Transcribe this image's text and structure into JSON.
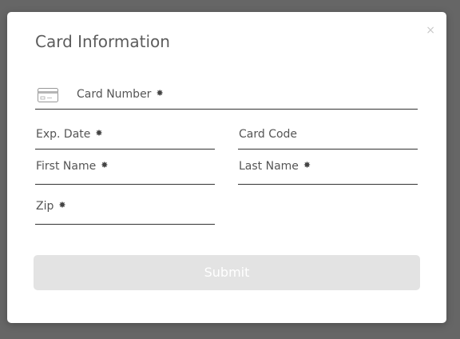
{
  "modal": {
    "title": "Card Information",
    "close_label": "×"
  },
  "form": {
    "card_number": {
      "label": "Card Number",
      "required": true
    },
    "exp_date": {
      "label": "Exp. Date",
      "required": true
    },
    "card_code": {
      "label": "Card Code",
      "required": false
    },
    "first_name": {
      "label": "First Name",
      "required": true
    },
    "last_name": {
      "label": "Last Name",
      "required": true
    },
    "zip": {
      "label": "Zip",
      "required": true
    },
    "required_marker": "✸"
  },
  "submit": {
    "label": "Submit"
  },
  "icons": {
    "card": "credit-card-icon"
  },
  "colors": {
    "backdrop": "#666666",
    "button_disabled": "#e3e3e3"
  }
}
